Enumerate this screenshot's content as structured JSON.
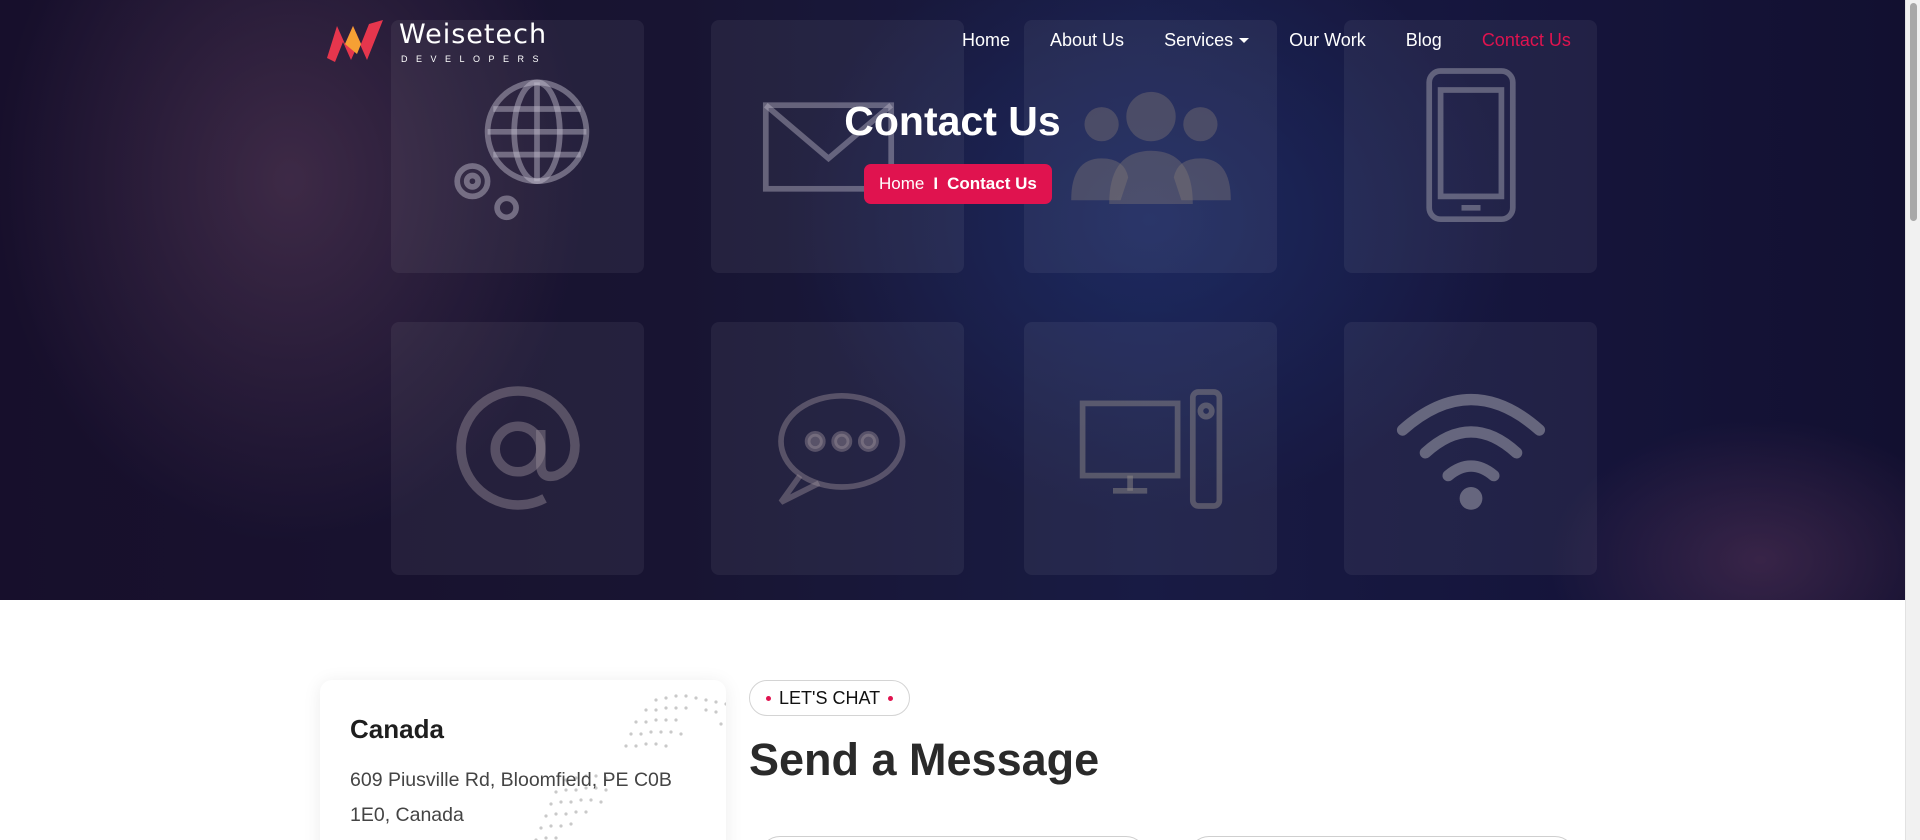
{
  "brand": {
    "name": "Weisetech",
    "tagline": "DEVELOPERS"
  },
  "nav": {
    "items": [
      {
        "label": "Home"
      },
      {
        "label": "About Us"
      },
      {
        "label": "Services"
      },
      {
        "label": "Our Work"
      },
      {
        "label": "Blog"
      },
      {
        "label": "Contact Us"
      }
    ],
    "active": "Contact Us"
  },
  "hero": {
    "title": "Contact Us",
    "breadcrumb": {
      "home": "Home",
      "separator": "I",
      "current": "Contact Us"
    },
    "tile_icons": [
      "globe-gears-icon",
      "envelope-icon",
      "people-icon",
      "smartphone-icon",
      "at-sign-icon",
      "chat-bubble-icon",
      "desktop-computer-icon",
      "wifi-icon"
    ]
  },
  "location_card": {
    "country": "Canada",
    "address": "609 Piusville Rd, Bloomfield, PE C0B 1E0, Canada"
  },
  "message_section": {
    "badge": "LET'S CHAT",
    "title": "Send a Message"
  },
  "colors": {
    "accent": "#e0134f",
    "hero_bg": "#1d1f48",
    "text_dark": "#222222"
  }
}
